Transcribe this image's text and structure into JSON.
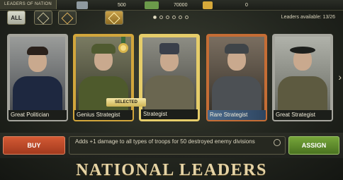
{
  "window": {
    "title": "LEADERS OF NATION"
  },
  "resources": [
    {
      "icon": "silver-icon",
      "value": "500"
    },
    {
      "icon": "cash-icon",
      "value": "70000"
    },
    {
      "icon": "gold-icon",
      "value": "0"
    }
  ],
  "filters": [
    {
      "label": "ALL",
      "active": true
    },
    {
      "label": "",
      "icon": "common-rank-icon"
    },
    {
      "label": "",
      "icon": "rare-rank-icon"
    },
    {
      "label": "",
      "icon": "elite-rank-icon"
    }
  ],
  "leaders_available": "Leaders available: 13/26",
  "cards": [
    {
      "label": "Great Politician",
      "rarity": "common"
    },
    {
      "label": "Genius Strategist",
      "rarity": "gold"
    },
    {
      "label": "Strategist",
      "rarity": "selected"
    },
    {
      "label": "Rare Strategist",
      "rarity": "rare"
    },
    {
      "label": "Great Strategist",
      "rarity": "common"
    }
  ],
  "selected_badge": "SELECTED",
  "buttons": {
    "buy": "BUY",
    "assign": "ASSIGN"
  },
  "description": "Adds +1 damage to all types of troops for 50 destroyed enemy divisions",
  "banner_title": "NATIONAL LEADERS",
  "colors": {
    "buy": "#c24a28",
    "assign": "#5f8c2c",
    "gold_frame": "#d2a63c",
    "rare_frame": "#c56d35"
  }
}
